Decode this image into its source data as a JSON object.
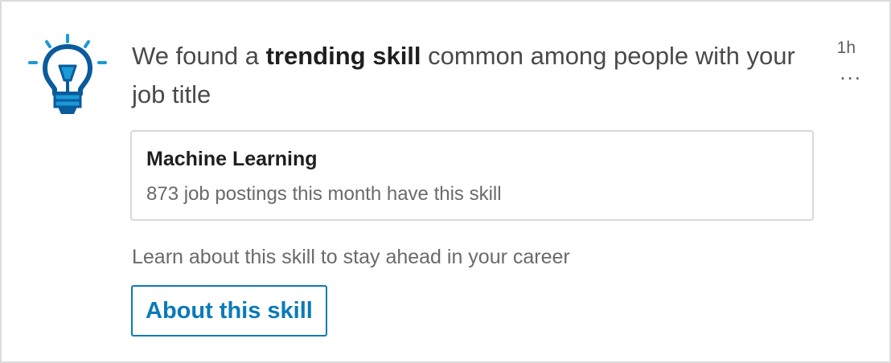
{
  "notification": {
    "headline_prefix": "We found a ",
    "headline_bold": "trending skill",
    "headline_suffix": " common among people with your job title",
    "time_ago": "1h",
    "more_label": "...",
    "icon": "lightbulb-icon",
    "accent_color": "#0a7ab8",
    "icon_color": "#0a5b9c",
    "icon_ray_color": "#1a9ad6"
  },
  "skill_card": {
    "name": "Machine Learning",
    "subtitle": "873 job postings this month have this skill"
  },
  "note": "Learn about this skill to stay ahead in your career",
  "cta": {
    "label": "About this skill"
  }
}
